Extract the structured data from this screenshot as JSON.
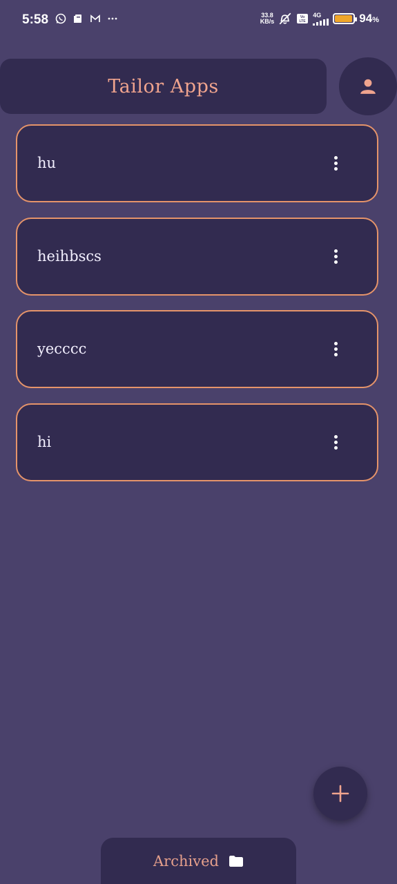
{
  "status_bar": {
    "time": "5:58",
    "net_speed_value": "33.8",
    "net_speed_unit": "KB/s",
    "network_type": "4G",
    "battery_percent": "94",
    "battery_unit": "%",
    "battery_level": 0.94,
    "left_icons": [
      "whatsapp-icon",
      "notes-icon",
      "gmail-icon",
      "more-dots-icon"
    ],
    "right_icons": [
      "mute-icon",
      "volte-icon",
      "signal-icon",
      "battery-icon"
    ]
  },
  "header": {
    "title": "Tailor Apps",
    "profile_icon": "person-icon"
  },
  "items": [
    {
      "title": "hu"
    },
    {
      "title": "heihbscs"
    },
    {
      "title": "yecccc"
    },
    {
      "title": "hi"
    }
  ],
  "fab": {
    "icon": "plus-icon"
  },
  "bottom_bar": {
    "label": "Archived",
    "icon": "folder-icon"
  },
  "colors": {
    "background": "#4a416b",
    "surface": "#322b50",
    "accent": "#f0a48e",
    "card_border": "#e6946a"
  }
}
